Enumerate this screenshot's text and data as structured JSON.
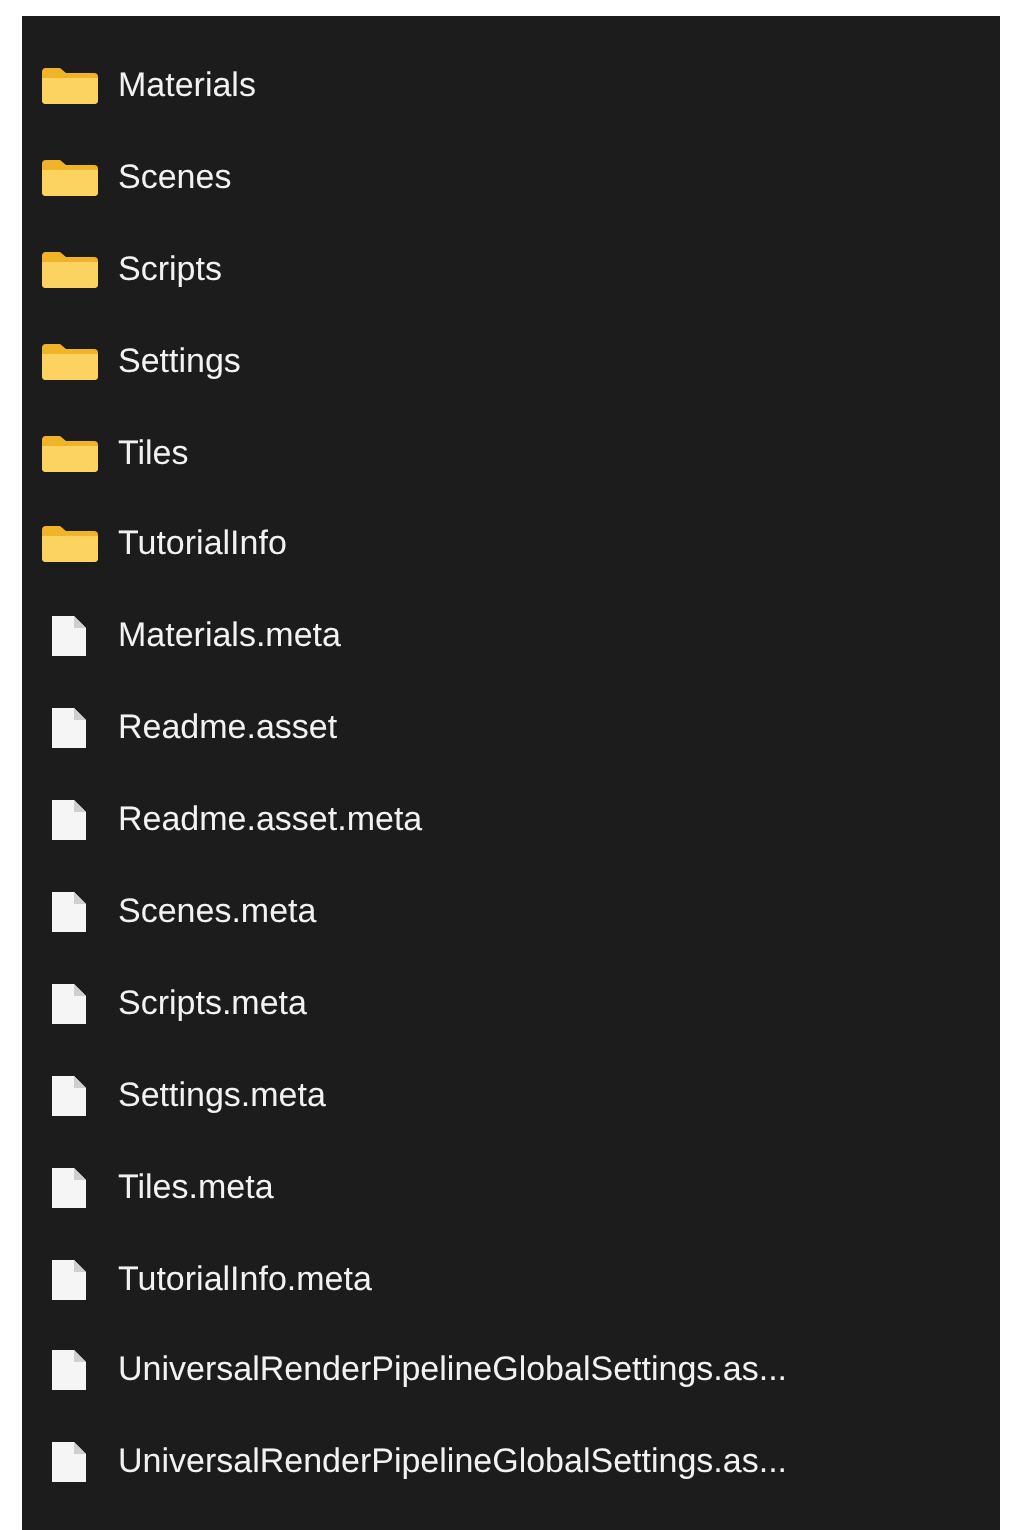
{
  "items": [
    {
      "kind": "folder",
      "name": "Materials"
    },
    {
      "kind": "folder",
      "name": "Scenes"
    },
    {
      "kind": "folder",
      "name": "Scripts"
    },
    {
      "kind": "folder",
      "name": "Settings"
    },
    {
      "kind": "folder",
      "name": "Tiles"
    },
    {
      "kind": "folder",
      "name": "TutorialInfo"
    },
    {
      "kind": "file",
      "name": "Materials.meta"
    },
    {
      "kind": "file",
      "name": "Readme.asset"
    },
    {
      "kind": "file",
      "name": "Readme.asset.meta"
    },
    {
      "kind": "file",
      "name": "Scenes.meta"
    },
    {
      "kind": "file",
      "name": "Scripts.meta"
    },
    {
      "kind": "file",
      "name": "Settings.meta"
    },
    {
      "kind": "file",
      "name": "Tiles.meta"
    },
    {
      "kind": "file",
      "name": "TutorialInfo.meta"
    },
    {
      "kind": "file",
      "name": "UniversalRenderPipelineGlobalSettings.as..."
    },
    {
      "kind": "file",
      "name": "UniversalRenderPipelineGlobalSettings.as..."
    }
  ]
}
